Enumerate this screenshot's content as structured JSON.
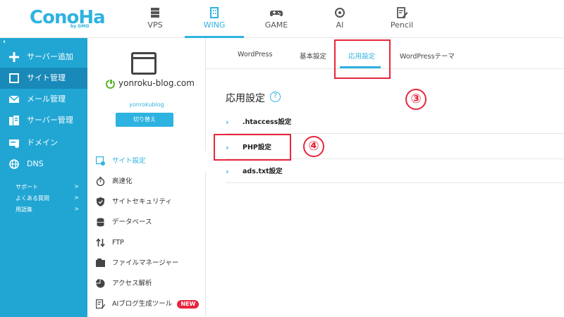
{
  "header": {
    "logo": "ConoHa",
    "logo_by": "by GMO",
    "nav": [
      {
        "label": "VPS",
        "icon": "server-icon"
      },
      {
        "label": "WING",
        "icon": "building-icon",
        "active": true
      },
      {
        "label": "GAME",
        "icon": "gamepad-icon"
      },
      {
        "label": "AI",
        "icon": "chip-icon"
      },
      {
        "label": "Pencil",
        "icon": "pencil-doc-icon"
      }
    ]
  },
  "sidebar": {
    "collapse": "‹",
    "items": [
      {
        "label": "サーバー追加",
        "icon": "plus-icon"
      },
      {
        "label": "サイト管理",
        "icon": "window-icon",
        "active": true
      },
      {
        "label": "メール管理",
        "icon": "mail-icon"
      },
      {
        "label": "サーバー管理",
        "icon": "server-manage-icon"
      },
      {
        "label": "ドメイン",
        "icon": "domain-icon"
      },
      {
        "label": "DNS",
        "icon": "globe-icon"
      }
    ],
    "sub": [
      {
        "label": "サポート",
        "chev": ">"
      },
      {
        "label": "よくある質問",
        "chev": ">"
      },
      {
        "label": "用語集",
        "chev": ">"
      }
    ]
  },
  "site": {
    "domain": "yonroku-blog.com",
    "user": "yonrokublog",
    "switch_label": "切り替え"
  },
  "site_menu": [
    {
      "label": "サイト設定",
      "icon": "site-settings-icon",
      "active": true
    },
    {
      "label": "高速化",
      "icon": "stopwatch-icon"
    },
    {
      "label": "サイトセキュリティ",
      "icon": "shield-icon"
    },
    {
      "label": "データベース",
      "icon": "database-icon"
    },
    {
      "label": "FTP",
      "icon": "transfer-icon"
    },
    {
      "label": "ファイルマネージャー",
      "icon": "folder-icon"
    },
    {
      "label": "アクセス解析",
      "icon": "pie-chart-icon"
    },
    {
      "label": "AIブログ生成ツール",
      "icon": "ai-doc-icon",
      "badge": "NEW"
    }
  ],
  "tabs": [
    {
      "label": "WordPress"
    },
    {
      "label": "基本設定"
    },
    {
      "label": "応用設定",
      "active": true
    },
    {
      "label": "WordPressテーマ"
    }
  ],
  "section": {
    "title": "応用設定",
    "help": "?",
    "rows": [
      {
        "label": ".htaccess設定"
      },
      {
        "label": "PHP設定"
      },
      {
        "label": "ads.txt設定"
      }
    ]
  },
  "annotations": {
    "step3": "③",
    "step4": "④",
    "accent": "#e8263d"
  },
  "colors": {
    "brand": "#2eb3e0",
    "sidebar": "#21a6d4",
    "sidebar_active": "#1889b8"
  }
}
